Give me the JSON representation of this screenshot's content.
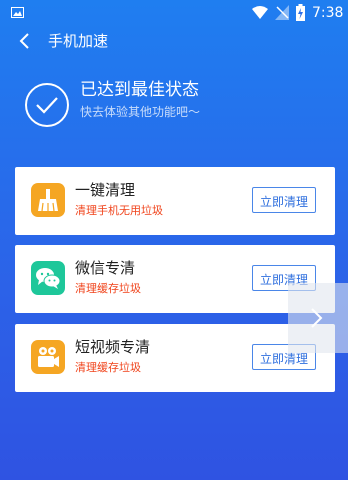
{
  "status_bar": {
    "time": "7:38"
  },
  "app_bar": {
    "title": "手机加速"
  },
  "status": {
    "title": "已达到最佳状态",
    "subtitle": "快去体验其他功能吧～"
  },
  "cards": [
    {
      "name": "一键清理",
      "desc": "清理手机无用垃圾",
      "action": "立即清理",
      "icon": "broom-icon",
      "icon_color": "#f5a623"
    },
    {
      "name": "微信专清",
      "desc": "清理缓存垃圾",
      "action": "立即清理",
      "icon": "wechat-icon",
      "icon_color": "#1ec79a"
    },
    {
      "name": "短视频专清",
      "desc": "清理缓存垃圾",
      "action": "立即清理",
      "icon": "video-camera-icon",
      "icon_color": "#f5a623"
    }
  ],
  "colors": {
    "background_top": "#1f7ef0",
    "background_bottom": "#2f53e2",
    "accent": "#2f6fde",
    "warning_text": "#f0441c"
  }
}
